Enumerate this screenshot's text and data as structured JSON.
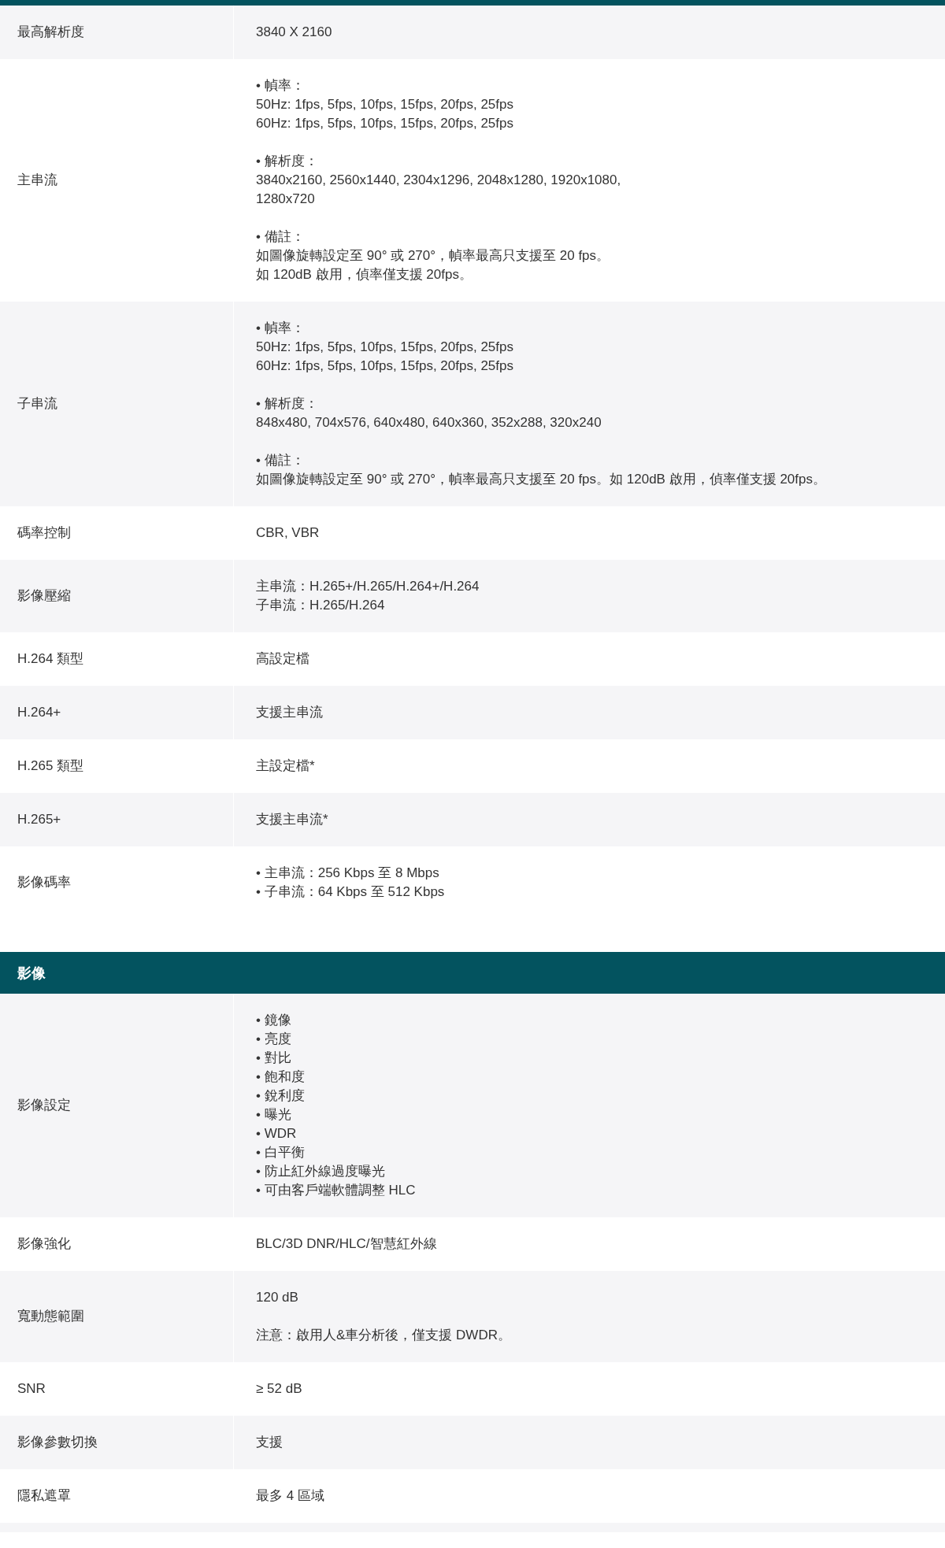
{
  "sections": [
    {
      "rows": [
        {
          "label": "最高解析度",
          "paragraphs": [
            [
              "3840 X 2160"
            ]
          ]
        },
        {
          "label": "主串流",
          "paragraphs": [
            [
              "• 幀率：",
              "50Hz: 1fps, 5fps, 10fps, 15fps, 20fps, 25fps",
              "60Hz: 1fps, 5fps, 10fps, 15fps, 20fps, 25fps"
            ],
            [
              "• 解析度：",
              "3840x2160, 2560x1440, 2304x1296, 2048x1280, 1920x1080,",
              "1280x720"
            ],
            [
              "• 備註：",
              "如圖像旋轉設定至 90° 或 270°，幀率最高只支援至 20 fps。",
              "如 120dB 啟用，偵率僅支援 20fps。"
            ]
          ]
        },
        {
          "label": "子串流",
          "paragraphs": [
            [
              "• 幀率：",
              "50Hz: 1fps, 5fps, 10fps, 15fps, 20fps, 25fps",
              "60Hz: 1fps, 5fps, 10fps, 15fps, 20fps, 25fps"
            ],
            [
              "• 解析度：",
              "848x480, 704x576, 640x480, 640x360, 352x288, 320x240"
            ],
            [
              "• 備註：",
              "如圖像旋轉設定至 90° 或 270°，幀率最高只支援至 20 fps。如 120dB 啟用，偵率僅支援 20fps。"
            ]
          ]
        },
        {
          "label": "碼率控制",
          "paragraphs": [
            [
              "CBR, VBR"
            ]
          ]
        },
        {
          "label": "影像壓縮",
          "paragraphs": [
            [
              "主串流：H.265+/H.265/H.264+/H.264",
              "子串流：H.265/H.264"
            ]
          ]
        },
        {
          "label": "H.264 類型",
          "paragraphs": [
            [
              "高設定檔"
            ]
          ]
        },
        {
          "label": "H.264+",
          "paragraphs": [
            [
              "支援主串流"
            ]
          ]
        },
        {
          "label": "H.265 類型",
          "paragraphs": [
            [
              "主設定檔*"
            ]
          ]
        },
        {
          "label": "H.265+",
          "paragraphs": [
            [
              "支援主串流*"
            ]
          ]
        },
        {
          "label": "影像碼率",
          "paragraphs": [
            [
              "• 主串流：256 Kbps 至 8 Mbps",
              "• 子串流：64 Kbps 至 512 Kbps"
            ]
          ]
        }
      ]
    },
    {
      "title": "影像",
      "rows": [
        {
          "label": "影像設定",
          "paragraphs": [
            [
              "• 鏡像",
              "• 亮度",
              "• 對比",
              "• 飽和度",
              "• 銳利度",
              "• 曝光",
              "• WDR",
              "• 白平衡",
              "• 防止紅外線過度曝光",
              "• 可由客戶端軟體調整 HLC"
            ]
          ]
        },
        {
          "label": "影像強化",
          "paragraphs": [
            [
              "BLC/3D DNR/HLC/智慧紅外線"
            ]
          ]
        },
        {
          "label": "寬動態範圍",
          "paragraphs": [
            [
              "120 dB"
            ],
            [
              "注意：啟用人&車分析後，僅支援 DWDR。"
            ]
          ]
        },
        {
          "label": "SNR",
          "paragraphs": [
            [
              "≥ 52 dB"
            ]
          ]
        },
        {
          "label": "影像參數切換",
          "paragraphs": [
            [
              "支援"
            ]
          ]
        },
        {
          "label": "隱私遮罩",
          "paragraphs": [
            [
              "最多 4 區域"
            ]
          ]
        }
      ]
    }
  ]
}
